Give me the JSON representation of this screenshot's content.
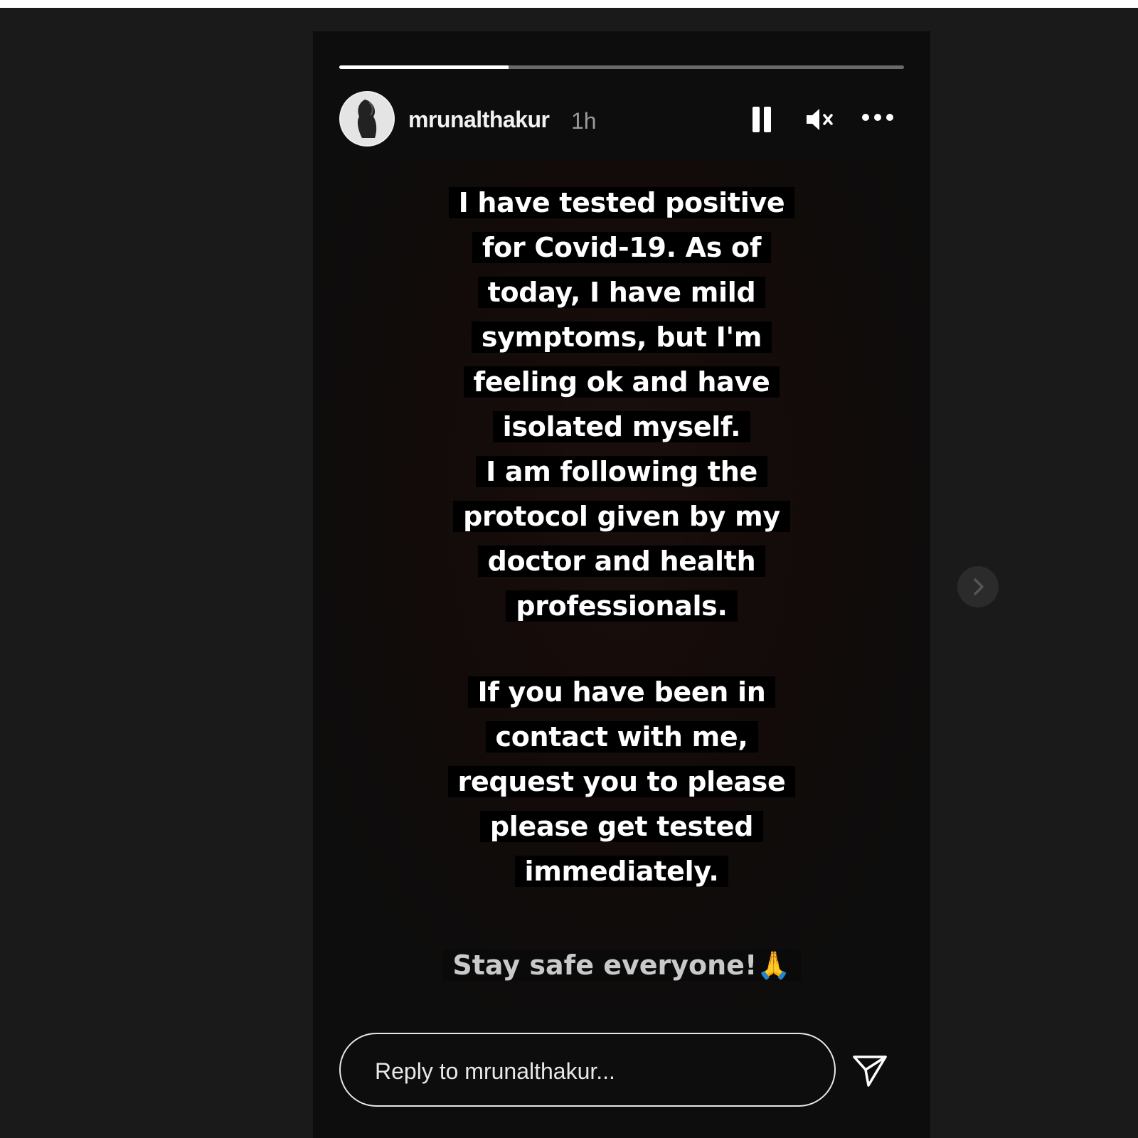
{
  "story": {
    "progress": 0.3,
    "user": {
      "username": "mrunalthakur",
      "timestamp": "1h"
    },
    "message_block_1": [
      "I have tested positive",
      "for Covid-19. As of",
      "today, I have mild",
      "symptoms, but I'm",
      "feeling ok and have",
      "isolated myself.",
      "I am following the",
      "protocol given by my",
      "doctor and health",
      "professionals."
    ],
    "message_block_2": [
      "If you have been in",
      "contact with me,",
      "request you to please",
      "please get tested",
      "immediately."
    ],
    "closing": "Stay safe everyone!",
    "closing_emoji": "🙏",
    "reply": {
      "placeholder": "Reply to mrunalthakur..."
    },
    "icons": {
      "pause": "pause-icon",
      "mute": "speaker-muted-icon",
      "more": "more-options-icon",
      "send": "send-paper-plane-icon",
      "next": "chevron-right-icon"
    },
    "colors": {
      "page_background": "#1a1a1a",
      "story_background": "#0d0d0d",
      "text": "#ffffff"
    }
  }
}
